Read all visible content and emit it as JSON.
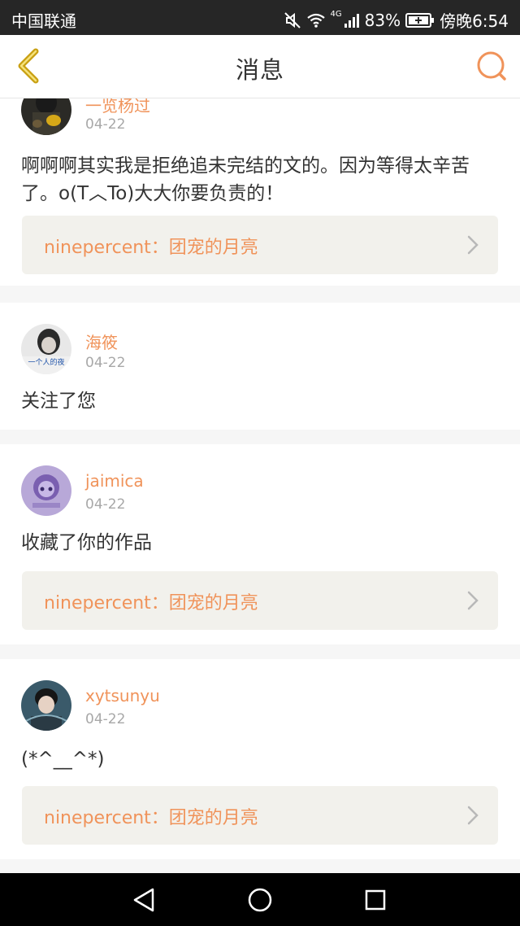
{
  "status_bar": {
    "carrier": "中国联通",
    "network": "4G",
    "battery": "83%",
    "time": "傍晚6:54"
  },
  "header": {
    "title": "消息",
    "back_icon": "chevron-left-icon",
    "search_icon": "search-icon"
  },
  "messages": [
    {
      "username": "一览杨过",
      "date": "04-22",
      "text": "啊啊啊其实我是拒绝追未完结的文的。因为等得太辛苦了。o(T︿To)大大你要负责的！",
      "work_link": "ninepercent：团宠的月亮"
    },
    {
      "username": "海筱",
      "date": "04-22",
      "text": "关注了您",
      "avatar_text": "一个人的夜"
    },
    {
      "username": "jaimica",
      "date": "04-22",
      "text": "收藏了你的作品",
      "work_link": "ninepercent：团宠的月亮"
    },
    {
      "username": "xytsunyu",
      "date": "04-22",
      "text": "(*^__^*)",
      "work_link": "ninepercent：团宠的月亮"
    }
  ],
  "colors": {
    "accent": "#f0935a",
    "back_icon": "#c9a012",
    "link_bg": "#f2f1ec"
  },
  "nav_bar": {
    "icons": [
      "back-triangle-icon",
      "home-circle-icon",
      "recents-square-icon"
    ]
  }
}
